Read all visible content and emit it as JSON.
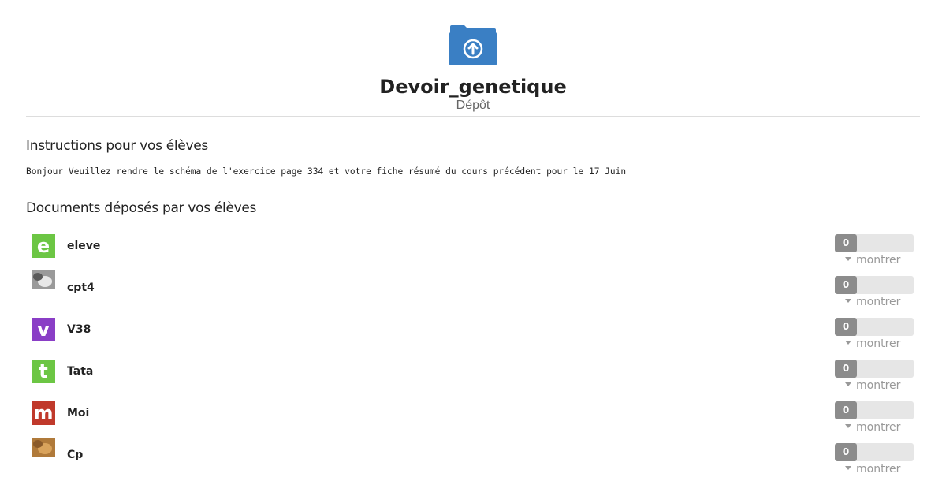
{
  "header": {
    "title": "Devoir_genetique",
    "subtitle": "Dépôt",
    "icon": "folder-upload-icon",
    "icon_color": "#3a7fc4"
  },
  "instructions": {
    "title": "Instructions pour vos élèves",
    "text": "Bonjour Veuillez rendre le schéma de l'exercice page 334 et votre fiche résumé du cours précédent pour le 17 Juin"
  },
  "documents": {
    "title": "Documents déposés par vos élèves",
    "show_label": "montrer",
    "students": [
      {
        "name": "eleve",
        "avatar_type": "letter",
        "avatar_letter": "e",
        "avatar_color": "#6cc644",
        "count": "0"
      },
      {
        "name": "cpt4",
        "avatar_type": "photo",
        "avatar_letter": "",
        "avatar_color": "#9a9a9a",
        "count": "0"
      },
      {
        "name": "V38",
        "avatar_type": "letter",
        "avatar_letter": "v",
        "avatar_color": "#8a3ec6",
        "count": "0"
      },
      {
        "name": "Tata",
        "avatar_type": "letter",
        "avatar_letter": "t",
        "avatar_color": "#6cc644",
        "count": "0"
      },
      {
        "name": "Moi",
        "avatar_type": "letter",
        "avatar_letter": "m",
        "avatar_color": "#c0392b",
        "count": "0"
      },
      {
        "name": "Cp",
        "avatar_type": "photo",
        "avatar_letter": "",
        "avatar_color": "#b07a3a",
        "count": "0"
      }
    ]
  }
}
